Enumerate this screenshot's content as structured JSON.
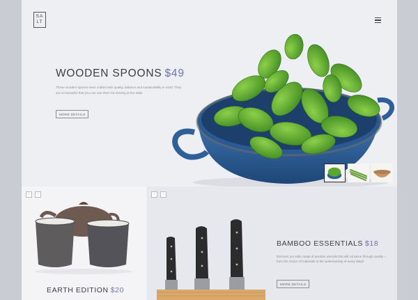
{
  "header": {
    "logo_line1": "SA",
    "logo_line2": "LT",
    "menu_icon": "hamburger-icon"
  },
  "hero": {
    "title": "WOODEN SPOONS",
    "price": "$49",
    "description": "These wooden spoons were crafted with quality, balance and sustainability in mind. They are so beautiful that you can use them for serving at the table",
    "button_label": "MORE DETAILS",
    "image": "salad-greens-in-blue-enamel-pot",
    "thumbnails": [
      "greens-thumbnail",
      "asparagus-thumbnail",
      "wooden-bowl-thumbnail"
    ]
  },
  "earth": {
    "title": "EARTH EDITION",
    "price": "$20",
    "image": "clay-teapot-and-cups",
    "prev_icon": "chevron-left-icon",
    "next_icon": "chevron-right-icon"
  },
  "bamboo": {
    "title": "BAMBOO ESSENTIALS",
    "price": "$18",
    "description": "Discover our wide range of wooden utensils that will convince through quality – from the choice of materials to the workmanship of every detail",
    "button_label": "MORE DETAILS",
    "image": "kitchen-knives-in-wooden-block",
    "prev_icon": "chevron-left-icon",
    "next_icon": "chevron-right-icon"
  },
  "arrow_glyphs": {
    "prev": "‹",
    "next": "›"
  },
  "colors": {
    "accent": "#6b73a8",
    "background": "#eeeff3",
    "pot_blue": "#2f5f98"
  }
}
